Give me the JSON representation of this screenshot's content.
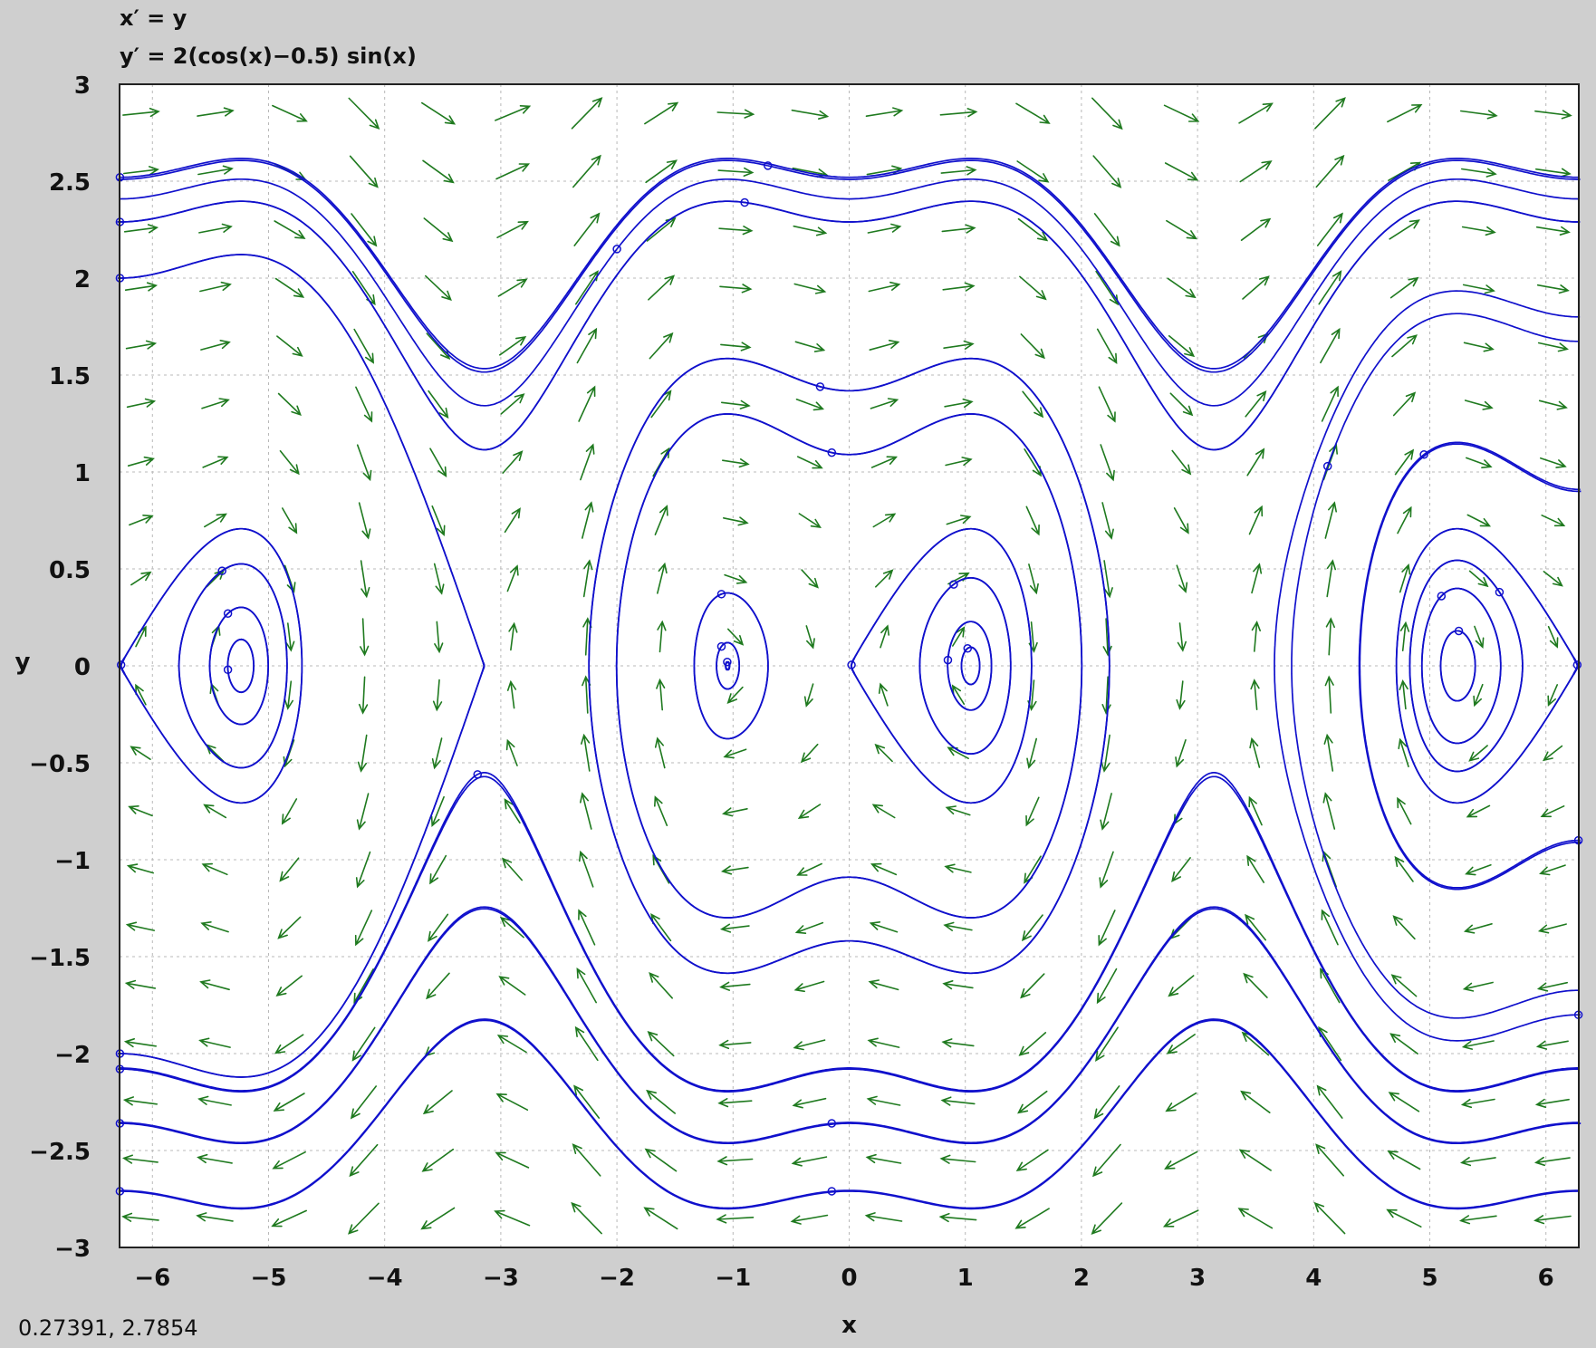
{
  "header": {
    "equation_x": "x′ = y",
    "equation_y": "y′ = 2(cos(x)−0.5) sin(x)"
  },
  "readout": "0.27391,  2.7854",
  "colors": {
    "background": "#cfcfcf",
    "plot_background": "#ffffff",
    "grid": "#b8b8b8",
    "arrows": "#1f7a1f",
    "trajectories": "#1010cc"
  },
  "chart_data": {
    "type": "phase-portrait",
    "system": {
      "dx": "y",
      "dy": "2*(cos(x)-0.5)*sin(x)"
    },
    "xlabel": "x",
    "ylabel": "y",
    "xlim": [
      -6.283,
      6.283
    ],
    "ylim": [
      -3,
      3
    ],
    "grid": true,
    "xticks": [
      -6,
      -5,
      -4,
      -3,
      -2,
      -1,
      0,
      1,
      2,
      3,
      4,
      5,
      6
    ],
    "xtick_labels": [
      "−6",
      "−5",
      "−4",
      "−3",
      "−2",
      "−1",
      "0",
      "1",
      "2",
      "3",
      "4",
      "5",
      "6"
    ],
    "yticks": [
      3,
      2.5,
      2,
      1.5,
      1,
      0.5,
      0,
      -0.5,
      -1,
      -1.5,
      -2,
      -2.5,
      -3
    ],
    "ytick_labels": [
      "3",
      "2.5",
      "2",
      "1.5",
      "1",
      "0.5",
      "0",
      "−0.5",
      "−1",
      "−1.5",
      "−2",
      "−2.5",
      "−3"
    ],
    "trajectory_seeds": [
      [
        -0.7,
        2.58
      ],
      [
        -0.9,
        2.39
      ],
      [
        -0.25,
        1.44
      ],
      [
        -0.15,
        1.1
      ],
      [
        -1.1,
        0.37
      ],
      [
        -1.1,
        0.1
      ],
      [
        -1.05,
        0.02
      ],
      [
        0.9,
        0.42
      ],
      [
        1.02,
        0.09
      ],
      [
        0.85,
        0.03
      ],
      [
        -5.4,
        0.49
      ],
      [
        -5.35,
        0.27
      ],
      [
        -5.35,
        -0.02
      ],
      [
        5.1,
        0.36
      ],
      [
        5.6,
        0.38
      ],
      [
        5.25,
        0.18
      ],
      [
        4.95,
        1.09
      ],
      [
        4.12,
        1.03
      ],
      [
        -3.2,
        -0.56
      ],
      [
        -0.15,
        -2.36
      ],
      [
        -0.15,
        -2.71
      ],
      [
        -2.0,
        2.15
      ],
      [
        -6.28,
        2.52
      ],
      [
        -6.28,
        2.29
      ],
      [
        -6.28,
        2.0
      ],
      [
        -6.28,
        -2.0
      ],
      [
        -6.28,
        -2.08
      ],
      [
        -6.28,
        -2.36
      ],
      [
        -6.28,
        -2.71
      ],
      [
        6.28,
        -0.9
      ],
      [
        6.28,
        -1.8
      ],
      [
        0.02,
        0.005
      ],
      [
        -6.27,
        0.005
      ],
      [
        6.27,
        0.005
      ]
    ]
  }
}
